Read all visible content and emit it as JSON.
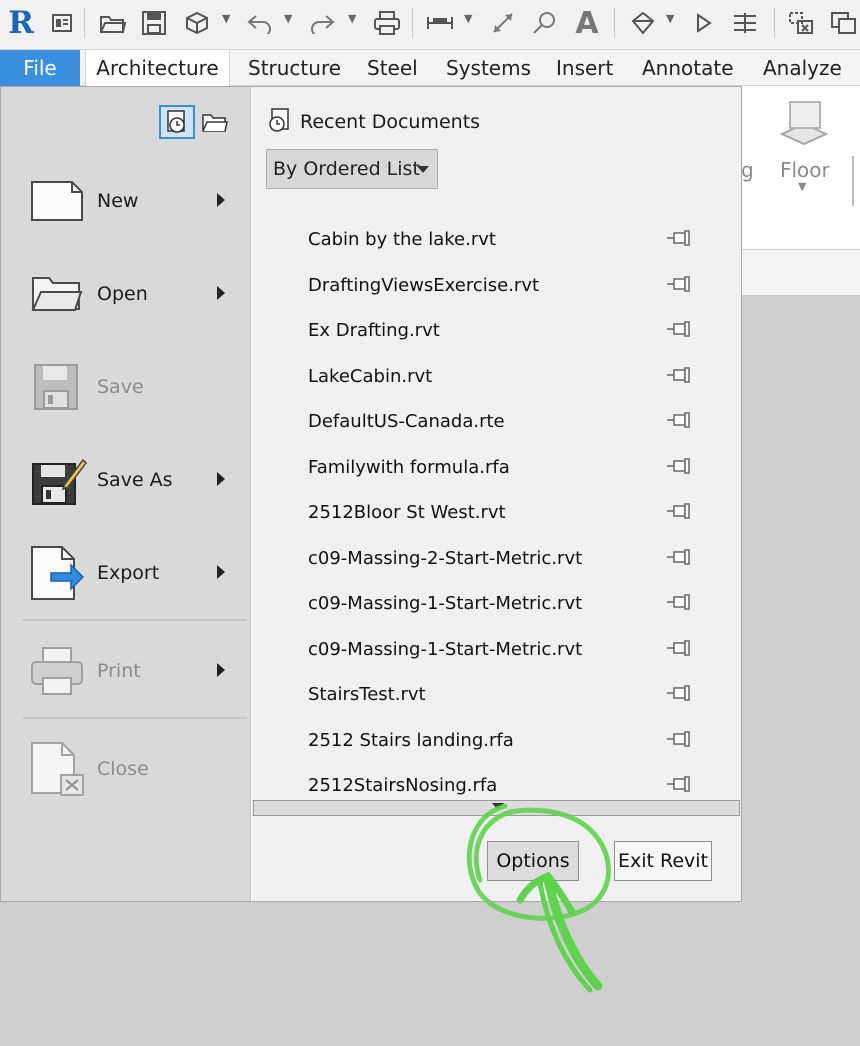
{
  "app": {
    "logo_letter": "R"
  },
  "ribbon_tabs": [
    {
      "label": "File"
    },
    {
      "label": "Architecture"
    },
    {
      "label": "Structure"
    },
    {
      "label": "Steel"
    },
    {
      "label": "Systems"
    },
    {
      "label": "Insert"
    },
    {
      "label": "Annotate"
    },
    {
      "label": "Analyze"
    }
  ],
  "ribbon_ghost": {
    "partial": "g",
    "floor": "Floor"
  },
  "left_menu": [
    {
      "label": "New"
    },
    {
      "label": "Open"
    },
    {
      "label": "Save"
    },
    {
      "label": "Save As"
    },
    {
      "label": "Export"
    },
    {
      "label": "Print"
    },
    {
      "label": "Close"
    }
  ],
  "recent": {
    "title": "Recent Documents",
    "sort_label": "By Ordered List",
    "documents": [
      "Cabin by the lake.rvt",
      "DraftingViewsExercise.rvt",
      "Ex Drafting.rvt",
      "LakeCabin.rvt",
      "DefaultUS-Canada.rte",
      "Familywith formula.rfa",
      "2512Bloor St West.rvt",
      "c09-Massing-2-Start-Metric.rvt",
      "c09-Massing-1-Start-Metric.rvt",
      "c09-Massing-1-Start-Metric.rvt",
      "StairsTest.rvt",
      "2512 Stairs landing.rfa",
      "2512StairsNosing.rfa"
    ]
  },
  "buttons": {
    "options": "Options",
    "exit": "Exit Revit"
  },
  "colors": {
    "file_tab": "#3a8fde",
    "annotation": "#5fd24e",
    "logo": "#1e64b4"
  }
}
